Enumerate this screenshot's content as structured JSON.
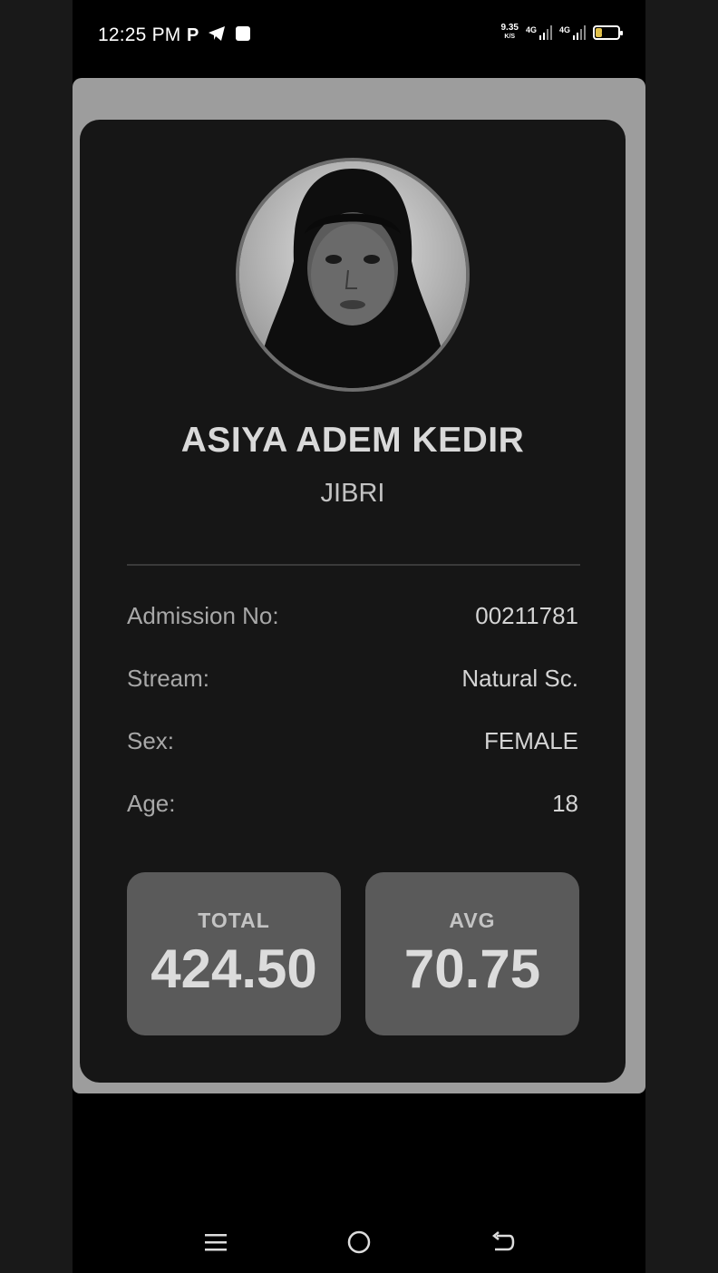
{
  "status_bar": {
    "time": "12:25 PM",
    "net_speed": "9.35",
    "net_unit": "K/S",
    "signal1_label": "4G",
    "signal2_label": "4G",
    "battery_percent": "25",
    "battery_level": 0.25,
    "left_icons": [
      "p-icon",
      "telegram-icon",
      "app-square-icon"
    ]
  },
  "profile": {
    "name": "ASIYA ADEM KEDIR",
    "subname": "JIBRI"
  },
  "details": [
    {
      "label": "Admission No:",
      "value": "00211781"
    },
    {
      "label": "Stream:",
      "value": "Natural Sc."
    },
    {
      "label": "Sex:",
      "value": "FEMALE"
    },
    {
      "label": "Age:",
      "value": "18"
    }
  ],
  "stats": {
    "total_label": "TOTAL",
    "total_value": "424.50",
    "avg_label": "AVG",
    "avg_value": "70.75"
  },
  "nav": [
    "menu-icon",
    "home-icon",
    "back-icon"
  ],
  "colors": {
    "card_bg": "#161616",
    "frame_bg": "#9d9d9d",
    "stat_bg": "#5a5a5a"
  }
}
